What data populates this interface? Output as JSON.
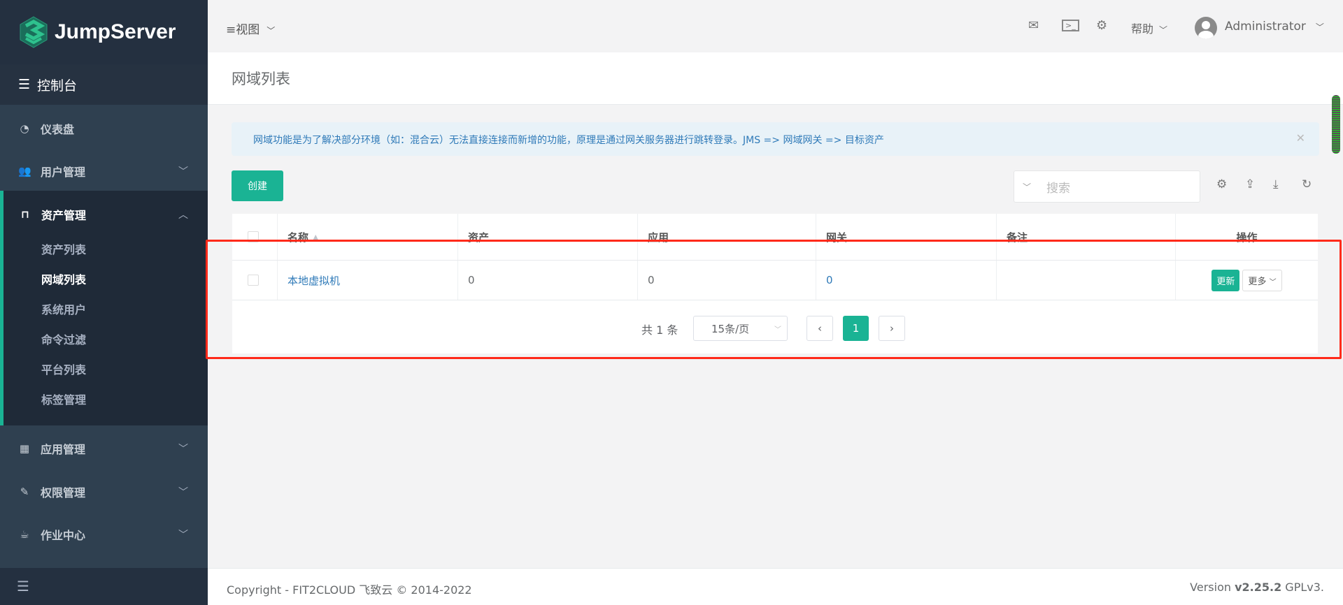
{
  "app": {
    "logo": "JumpServer",
    "console": "控制台"
  },
  "sidebar": {
    "items": [
      {
        "label": "仪表盘",
        "icon": "dashboard-icon"
      },
      {
        "label": "用户管理",
        "icon": "users-icon"
      },
      {
        "label": "资产管理",
        "icon": "inbox-icon"
      },
      {
        "label": "应用管理",
        "icon": "grid-icon"
      },
      {
        "label": "权限管理",
        "icon": "edit-icon"
      },
      {
        "label": "作业中心",
        "icon": "coffee-icon"
      }
    ],
    "sub": [
      "资产列表",
      "网域列表",
      "系统用户",
      "命令过滤",
      "平台列表",
      "标签管理"
    ]
  },
  "header": {
    "view": "视图",
    "help": "帮助",
    "user": "Administrator"
  },
  "page": {
    "title": "网域列表",
    "alert": "网域功能是为了解决部分环境（如：混合云）无法直接连接而新增的功能，原理是通过网关服务器进行跳转登录。JMS => 网域网关 => 目标资产",
    "create": "创建",
    "search_placeholder": "搜索"
  },
  "table": {
    "columns": [
      "名称",
      "资产",
      "应用",
      "网关",
      "备注",
      "操作"
    ],
    "rows": [
      {
        "name": "本地虚拟机",
        "assets": "0",
        "apps": "0",
        "gateways": "0",
        "comment": "",
        "update": "更新",
        "more": "更多"
      }
    ]
  },
  "pagination": {
    "total": "共 1 条",
    "page_size": "15条/页",
    "current": "1"
  },
  "footer": {
    "copyright": "Copyright - FIT2CLOUD 飞致云 © 2014-2022",
    "version_prefix": "Version ",
    "version": "v2.25.2",
    "license": " GPLv3."
  }
}
